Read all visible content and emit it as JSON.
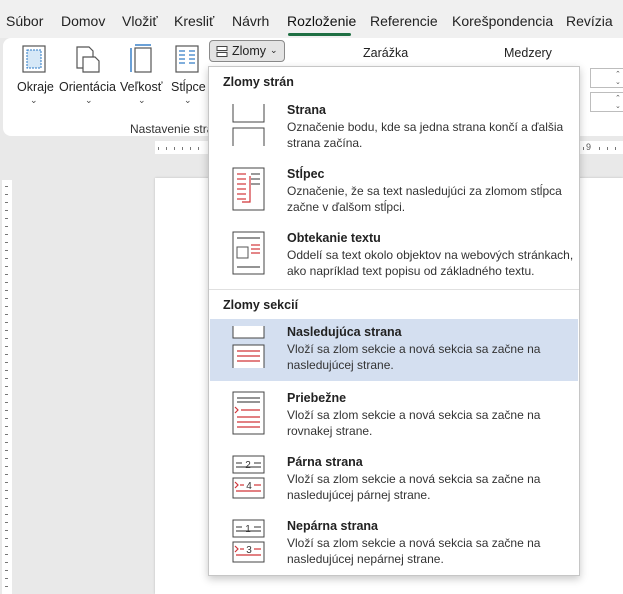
{
  "tabs": [
    {
      "label": "Súbor"
    },
    {
      "label": "Domov"
    },
    {
      "label": "Vložiť"
    },
    {
      "label": "Kresliť"
    },
    {
      "label": "Návrh"
    },
    {
      "label": "Rozloženie"
    },
    {
      "label": "Referencie"
    },
    {
      "label": "Korešpondencia"
    },
    {
      "label": "Revízia"
    }
  ],
  "ribbon": {
    "buttons": [
      {
        "label": "Okraje"
      },
      {
        "label": "Orientácia"
      },
      {
        "label": "Veľkosť"
      },
      {
        "label": "Stĺpce"
      }
    ],
    "group_label": "Nastavenie stran",
    "zlomy_label": "Zlomy",
    "zarazka_label": "Zarážka",
    "medzery_label": "Medzery"
  },
  "ruler": {
    "num9": "9"
  },
  "dropdown": {
    "section1": "Zlomy strán",
    "section2": "Zlomy sekcií",
    "items": [
      {
        "title": "Strana",
        "desc": "Označenie bodu, kde sa jedna strana končí a ďalšia strana začína."
      },
      {
        "title": "Stĺpec",
        "desc": "Označenie, že sa text nasledujúci za zlomom stĺpca začne v ďalšom stĺpci."
      },
      {
        "title": "Obtekanie textu",
        "desc": "Oddelí sa text okolo objektov na webových stránkach, ako napríklad text popisu od základného textu."
      },
      {
        "title": "Nasledujúca strana",
        "desc": "Vloží sa zlom sekcie a nová sekcia sa začne na nasledujúcej strane."
      },
      {
        "title": "Priebežne",
        "desc": "Vloží sa zlom sekcie a nová sekcia sa začne na rovnakej strane."
      },
      {
        "title": "Párna strana",
        "desc": "Vloží sa zlom sekcie a nová sekcia sa začne na nasledujúcej párnej strane."
      },
      {
        "title": "Nepárna strana",
        "desc": "Vloží sa zlom sekcie a nová sekcia sa začne na nasledujúcej nepárnej strane."
      }
    ],
    "icon_numbers": {
      "even_top": "2",
      "even_bottom": "4",
      "odd_top": "1",
      "odd_bottom": "3"
    }
  },
  "colors": {
    "accent": "#1f6f43",
    "highlight": "#d4dff0",
    "break_red": "#d13438",
    "arrow_blue": "#2b78c5"
  }
}
